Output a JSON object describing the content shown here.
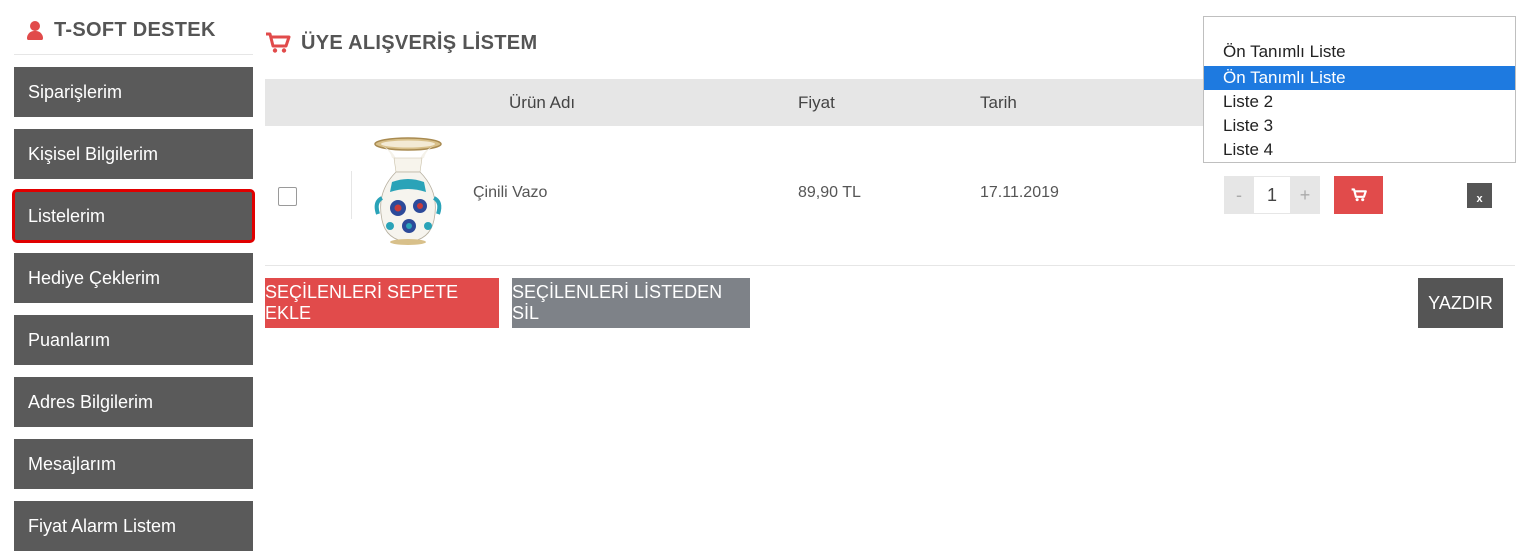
{
  "sidebar": {
    "title": "T-SOFT DESTEK",
    "items": [
      {
        "label": "Siparişlerim"
      },
      {
        "label": "Kişisel Bilgilerim"
      },
      {
        "label": "Listelerim"
      },
      {
        "label": "Hediye Çeklerim"
      },
      {
        "label": "Puanlarım"
      },
      {
        "label": "Adres Bilgilerim"
      },
      {
        "label": "Mesajlarım"
      },
      {
        "label": "Fiyat Alarm Listem"
      }
    ],
    "active_index": 2
  },
  "main": {
    "title": "ÜYE ALIŞVERİŞ LİSTEM",
    "columns": {
      "product": "Ürün Adı",
      "price": "Fiyat",
      "date": "Tarih"
    },
    "rows": [
      {
        "name": "Çinili Vazo",
        "price": "89,90 TL",
        "date": "17.11.2019",
        "quantity": "1"
      }
    ],
    "qty_minus": "-",
    "qty_plus": "+",
    "remove_label": "x",
    "buttons": {
      "add_selected": "SEÇİLENLERİ SEPETE EKLE",
      "remove_selected": "SEÇİLENLERİ LİSTEDEN SİL",
      "print": "YAZDIR"
    }
  },
  "list_select": {
    "selected": "Ön Tanımlı Liste",
    "options": [
      "Ön Tanımlı Liste",
      "Liste 2",
      "Liste 3",
      "Liste 4"
    ],
    "highlighted_index": 0
  },
  "colors": {
    "accent": "#e14b4b",
    "sidebar_bg": "#5a5a5a",
    "highlight": "#1e7ae0",
    "active_outline": "#e00000"
  },
  "icons": {
    "user": "user-icon",
    "cart": "shopping-cart-icon"
  }
}
